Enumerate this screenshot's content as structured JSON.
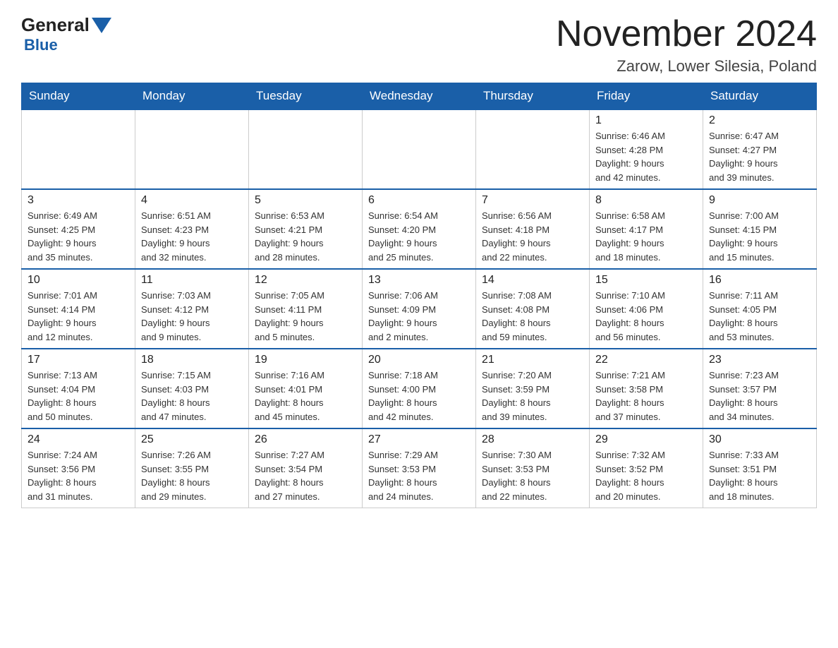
{
  "logo": {
    "text1": "General",
    "text2": "Blue"
  },
  "header": {
    "title": "November 2024",
    "location": "Zarow, Lower Silesia, Poland"
  },
  "weekdays": [
    "Sunday",
    "Monday",
    "Tuesday",
    "Wednesday",
    "Thursday",
    "Friday",
    "Saturday"
  ],
  "weeks": [
    [
      {
        "day": "",
        "info": ""
      },
      {
        "day": "",
        "info": ""
      },
      {
        "day": "",
        "info": ""
      },
      {
        "day": "",
        "info": ""
      },
      {
        "day": "",
        "info": ""
      },
      {
        "day": "1",
        "info": "Sunrise: 6:46 AM\nSunset: 4:28 PM\nDaylight: 9 hours\nand 42 minutes."
      },
      {
        "day": "2",
        "info": "Sunrise: 6:47 AM\nSunset: 4:27 PM\nDaylight: 9 hours\nand 39 minutes."
      }
    ],
    [
      {
        "day": "3",
        "info": "Sunrise: 6:49 AM\nSunset: 4:25 PM\nDaylight: 9 hours\nand 35 minutes."
      },
      {
        "day": "4",
        "info": "Sunrise: 6:51 AM\nSunset: 4:23 PM\nDaylight: 9 hours\nand 32 minutes."
      },
      {
        "day": "5",
        "info": "Sunrise: 6:53 AM\nSunset: 4:21 PM\nDaylight: 9 hours\nand 28 minutes."
      },
      {
        "day": "6",
        "info": "Sunrise: 6:54 AM\nSunset: 4:20 PM\nDaylight: 9 hours\nand 25 minutes."
      },
      {
        "day": "7",
        "info": "Sunrise: 6:56 AM\nSunset: 4:18 PM\nDaylight: 9 hours\nand 22 minutes."
      },
      {
        "day": "8",
        "info": "Sunrise: 6:58 AM\nSunset: 4:17 PM\nDaylight: 9 hours\nand 18 minutes."
      },
      {
        "day": "9",
        "info": "Sunrise: 7:00 AM\nSunset: 4:15 PM\nDaylight: 9 hours\nand 15 minutes."
      }
    ],
    [
      {
        "day": "10",
        "info": "Sunrise: 7:01 AM\nSunset: 4:14 PM\nDaylight: 9 hours\nand 12 minutes."
      },
      {
        "day": "11",
        "info": "Sunrise: 7:03 AM\nSunset: 4:12 PM\nDaylight: 9 hours\nand 9 minutes."
      },
      {
        "day": "12",
        "info": "Sunrise: 7:05 AM\nSunset: 4:11 PM\nDaylight: 9 hours\nand 5 minutes."
      },
      {
        "day": "13",
        "info": "Sunrise: 7:06 AM\nSunset: 4:09 PM\nDaylight: 9 hours\nand 2 minutes."
      },
      {
        "day": "14",
        "info": "Sunrise: 7:08 AM\nSunset: 4:08 PM\nDaylight: 8 hours\nand 59 minutes."
      },
      {
        "day": "15",
        "info": "Sunrise: 7:10 AM\nSunset: 4:06 PM\nDaylight: 8 hours\nand 56 minutes."
      },
      {
        "day": "16",
        "info": "Sunrise: 7:11 AM\nSunset: 4:05 PM\nDaylight: 8 hours\nand 53 minutes."
      }
    ],
    [
      {
        "day": "17",
        "info": "Sunrise: 7:13 AM\nSunset: 4:04 PM\nDaylight: 8 hours\nand 50 minutes."
      },
      {
        "day": "18",
        "info": "Sunrise: 7:15 AM\nSunset: 4:03 PM\nDaylight: 8 hours\nand 47 minutes."
      },
      {
        "day": "19",
        "info": "Sunrise: 7:16 AM\nSunset: 4:01 PM\nDaylight: 8 hours\nand 45 minutes."
      },
      {
        "day": "20",
        "info": "Sunrise: 7:18 AM\nSunset: 4:00 PM\nDaylight: 8 hours\nand 42 minutes."
      },
      {
        "day": "21",
        "info": "Sunrise: 7:20 AM\nSunset: 3:59 PM\nDaylight: 8 hours\nand 39 minutes."
      },
      {
        "day": "22",
        "info": "Sunrise: 7:21 AM\nSunset: 3:58 PM\nDaylight: 8 hours\nand 37 minutes."
      },
      {
        "day": "23",
        "info": "Sunrise: 7:23 AM\nSunset: 3:57 PM\nDaylight: 8 hours\nand 34 minutes."
      }
    ],
    [
      {
        "day": "24",
        "info": "Sunrise: 7:24 AM\nSunset: 3:56 PM\nDaylight: 8 hours\nand 31 minutes."
      },
      {
        "day": "25",
        "info": "Sunrise: 7:26 AM\nSunset: 3:55 PM\nDaylight: 8 hours\nand 29 minutes."
      },
      {
        "day": "26",
        "info": "Sunrise: 7:27 AM\nSunset: 3:54 PM\nDaylight: 8 hours\nand 27 minutes."
      },
      {
        "day": "27",
        "info": "Sunrise: 7:29 AM\nSunset: 3:53 PM\nDaylight: 8 hours\nand 24 minutes."
      },
      {
        "day": "28",
        "info": "Sunrise: 7:30 AM\nSunset: 3:53 PM\nDaylight: 8 hours\nand 22 minutes."
      },
      {
        "day": "29",
        "info": "Sunrise: 7:32 AM\nSunset: 3:52 PM\nDaylight: 8 hours\nand 20 minutes."
      },
      {
        "day": "30",
        "info": "Sunrise: 7:33 AM\nSunset: 3:51 PM\nDaylight: 8 hours\nand 18 minutes."
      }
    ]
  ]
}
